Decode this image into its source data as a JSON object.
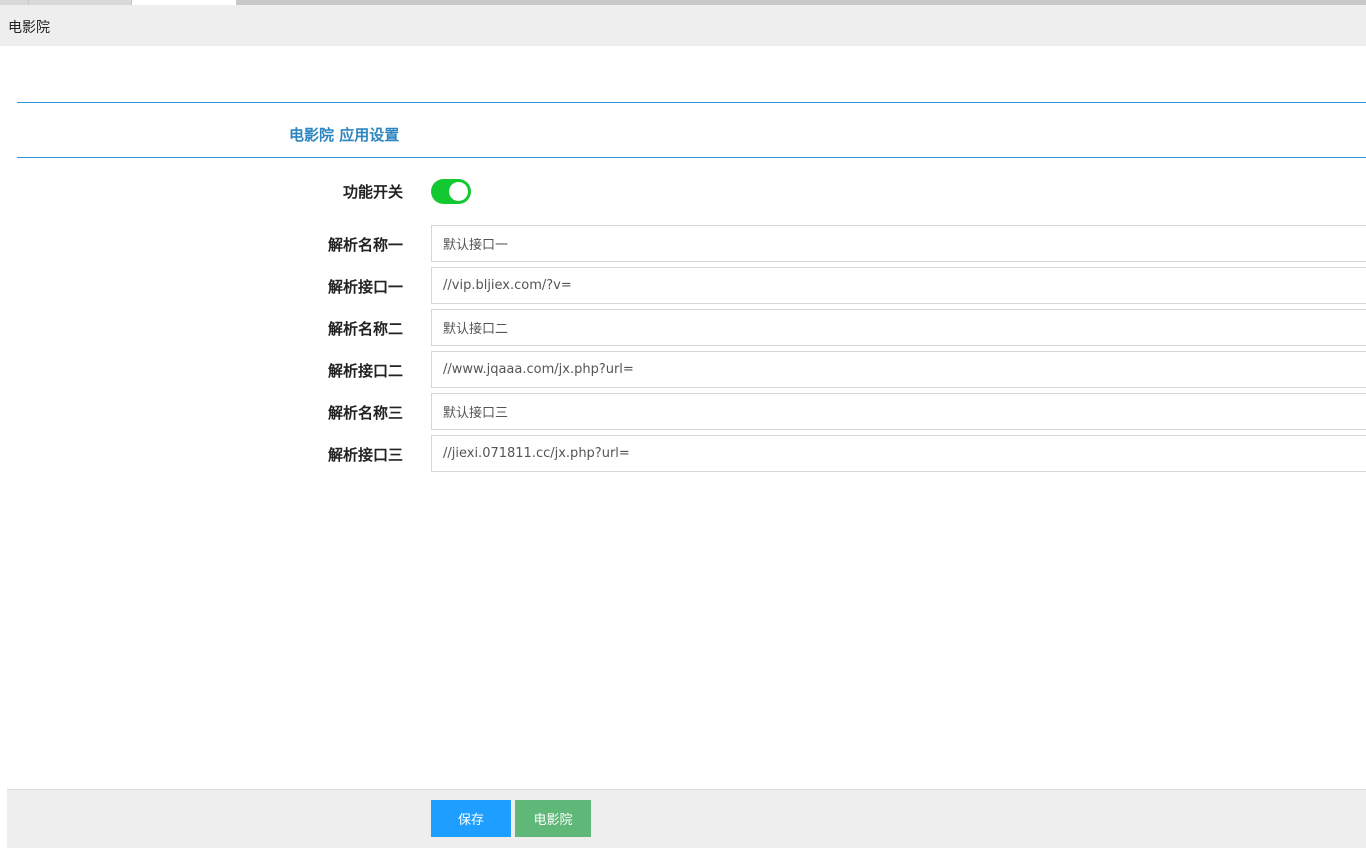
{
  "header": {
    "breadcrumb": "电影院"
  },
  "section": {
    "title": "电影院 应用设置"
  },
  "form": {
    "switch": {
      "label": "功能开关",
      "enabled": true,
      "color": "#13c932"
    },
    "fields": [
      {
        "label": "解析名称一",
        "value": "默认接口一"
      },
      {
        "label": "解析接口一",
        "value": "//vip.bljiex.com/?v="
      },
      {
        "label": "解析名称二",
        "value": "默认接口二"
      },
      {
        "label": "解析接口二",
        "value": "//www.jqaaa.com/jx.php?url="
      },
      {
        "label": "解析名称三",
        "value": "默认接口三"
      },
      {
        "label": "解析接口三",
        "value": "//jiexi.071811.cc/jx.php?url="
      }
    ]
  },
  "footer": {
    "save_label": "保存",
    "app_label": "电影院",
    "save_color": "#1e9fff",
    "app_color": "#5fb878"
  }
}
